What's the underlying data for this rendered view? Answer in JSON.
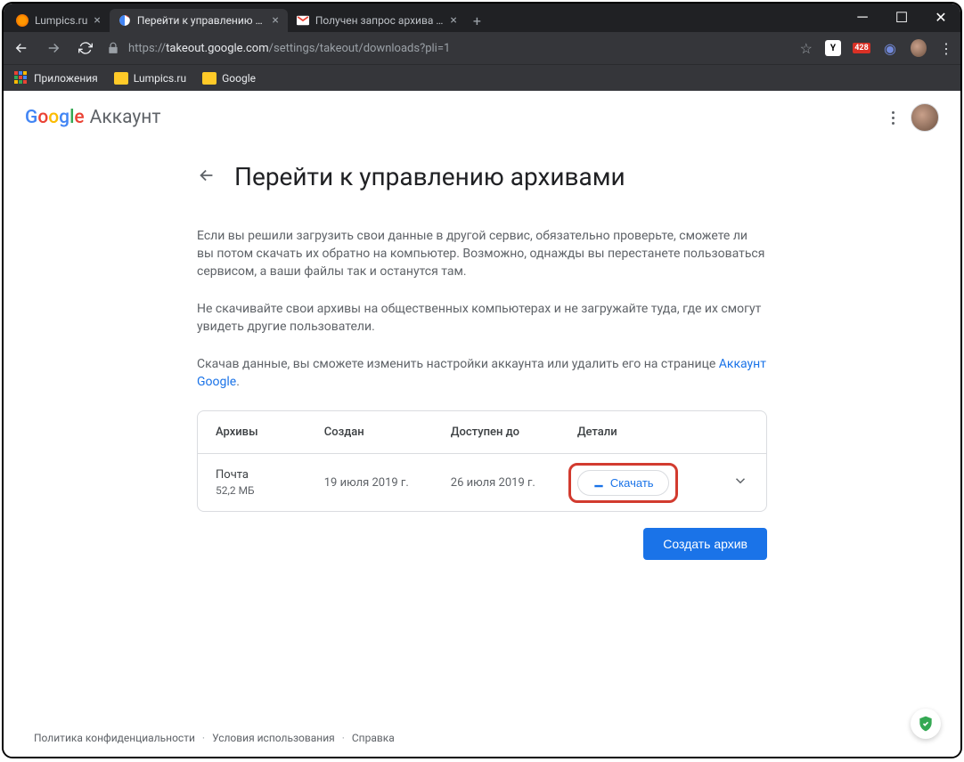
{
  "tabs": [
    {
      "title": "Lumpics.ru",
      "active": false
    },
    {
      "title": "Перейти к управлению архивам",
      "active": true
    },
    {
      "title": "Получен запрос архива данных",
      "active": false
    }
  ],
  "url": {
    "scheme": "https://",
    "host": "takeout.google.com",
    "path": "/settings/takeout/downloads?pli=1"
  },
  "badge": "428",
  "bookmarks": {
    "apps": "Приложения",
    "folder1": "Lumpics.ru",
    "folder2": "Google"
  },
  "brand": {
    "google": "Google",
    "account": "Аккаунт"
  },
  "page": {
    "title": "Перейти к управлению архивами",
    "p1": "Если вы решили загрузить свои данные в другой сервис, обязательно проверьте, сможете ли вы потом скачать их обратно на компьютер. Возможно, однажды вы перестанете пользоваться сервисом, а ваши файлы так и останутся там.",
    "p2": "Не скачивайте свои архивы на общественных компьютерах и не загружайте туда, где их смогут увидеть другие пользователи.",
    "p3a": "Скачав данные, вы сможете изменить настройки аккаунта или удалить его на странице ",
    "p3link": "Аккаунт Google",
    "p3b": "."
  },
  "table": {
    "h1": "Архивы",
    "h2": "Создан",
    "h3": "Доступен до",
    "h4": "Детали",
    "row": {
      "name": "Почта",
      "size": "52,2 МБ",
      "created": "19 июля 2019 г.",
      "until": "26 июля 2019 г.",
      "download": "Скачать"
    }
  },
  "create": "Создать архив",
  "footer": {
    "privacy": "Политика конфиденциальности",
    "terms": "Условия использования",
    "help": "Справка"
  }
}
